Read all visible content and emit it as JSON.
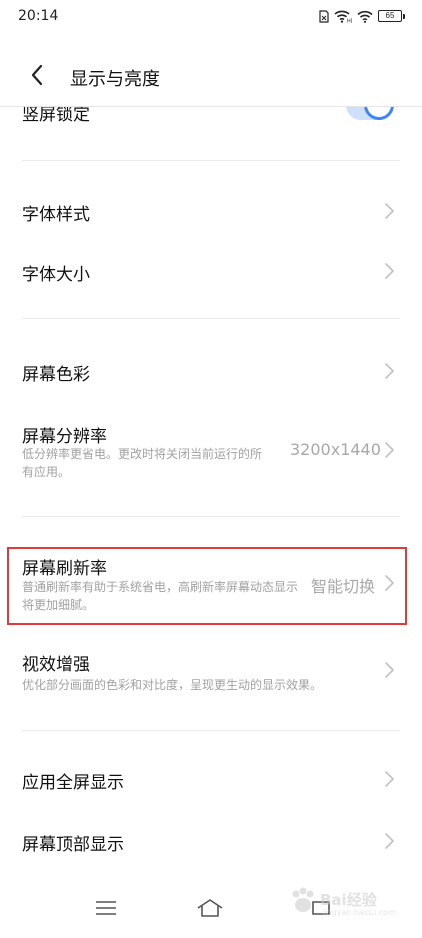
{
  "status_bar": {
    "time": "20:14",
    "battery": "65",
    "icons": [
      "sim-card-icon",
      "wifi-hd-icon",
      "wifi-icon",
      "battery-icon"
    ]
  },
  "header": {
    "title": "显示与亮度",
    "back_icon": "back-arrow-icon"
  },
  "partial_row": {
    "label": "竖屏锁定",
    "toggle_on": true
  },
  "sections": [
    {
      "rows": [
        {
          "id": "font-style",
          "label": "字体样式"
        },
        {
          "id": "font-size",
          "label": "字体大小"
        }
      ]
    },
    {
      "rows": [
        {
          "id": "screen-color",
          "label": "屏幕色彩"
        },
        {
          "id": "screen-resolution",
          "label": "屏幕分辨率",
          "description": "低分辨率更省电。更改时将关闭当前运行的所有应用。",
          "value": "3200x1440"
        }
      ]
    },
    {
      "rows": [
        {
          "id": "refresh-rate",
          "label": "屏幕刷新率",
          "description": "普通刷新率有助于系统省电，高刷新率屏幕动态显示将更加细腻。",
          "value": "智能切换",
          "highlighted": true
        },
        {
          "id": "visual-enhance",
          "label": "视效增强",
          "description": "优化部分画面的色彩和对比度，呈现更生动的显示效果。"
        }
      ]
    },
    {
      "rows": [
        {
          "id": "fullscreen-apps",
          "label": "应用全屏显示"
        },
        {
          "id": "top-display",
          "label": "屏幕顶部显示"
        }
      ]
    }
  ],
  "colors": {
    "accent": "#3d86f7",
    "highlight": "#e03b3b",
    "secondary_text": "#a2a2a2"
  },
  "nav_bar": {
    "icons": [
      "menu-icon",
      "home-icon",
      "back-icon"
    ]
  },
  "watermark": {
    "text": "Bai经验",
    "sub": "jingyan.baidu.com"
  }
}
